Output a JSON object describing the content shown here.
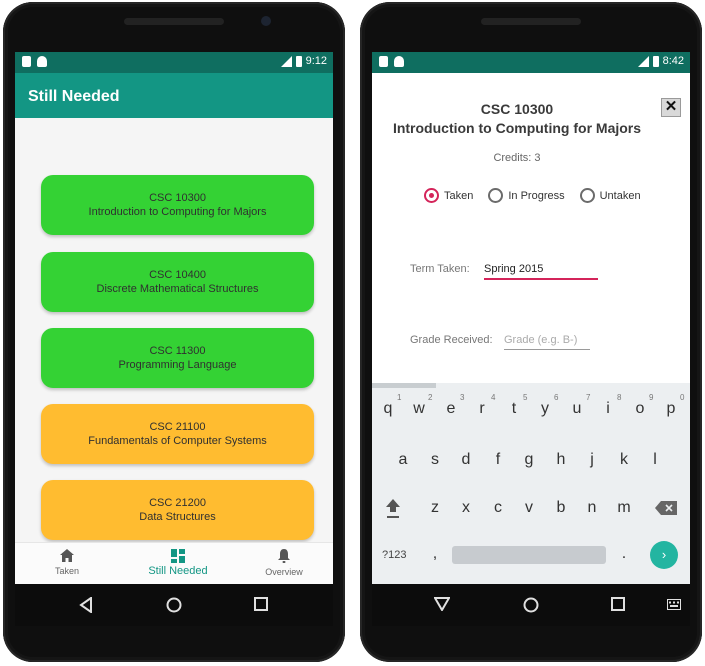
{
  "left_phone": {
    "statusbar": {
      "time": "9:12",
      "network": "LTE"
    },
    "app_bar": {
      "title": "Still Needed"
    },
    "courses": [
      {
        "code": "CSC 10300",
        "name": "Introduction to Computing for Majors",
        "status": "taken",
        "color": "#34d234"
      },
      {
        "code": "CSC 10400",
        "name": "Discrete Mathematical Structures",
        "status": "taken",
        "color": "#34d234"
      },
      {
        "code": "CSC 11300",
        "name": "Programming Language",
        "status": "taken",
        "color": "#34d234"
      },
      {
        "code": "CSC 21100",
        "name": "Fundamentals of Computer Systems",
        "status": "needed",
        "color": "#ffbc30"
      },
      {
        "code": "CSC 21200",
        "name": "Data Structures",
        "status": "needed",
        "color": "#ffbc30"
      }
    ],
    "bottom_nav": {
      "items": [
        {
          "label": "Taken",
          "icon": "home-icon",
          "active": false
        },
        {
          "label": "Still Needed",
          "icon": "dashboard-icon",
          "active": true
        },
        {
          "label": "Overview",
          "icon": "bell-icon",
          "active": false
        }
      ]
    }
  },
  "right_phone": {
    "statusbar": {
      "time": "8:42",
      "network": "LTE"
    },
    "dialog": {
      "close_label": "✕",
      "course_code": "CSC 10300",
      "course_name": "Introduction to Computing for Majors",
      "credits": "Credits: 3",
      "status_options": [
        {
          "label": "Taken",
          "checked": true
        },
        {
          "label": "In Progress",
          "checked": false
        },
        {
          "label": "Untaken",
          "checked": false
        }
      ],
      "term_label": "Term Taken:",
      "term_value": "Spring 2015",
      "grade_label": "Grade Received:",
      "grade_placeholder": "Grade (e.g. B-)"
    },
    "keyboard": {
      "row1": [
        "q",
        "w",
        "e",
        "r",
        "t",
        "y",
        "u",
        "i",
        "o",
        "p"
      ],
      "row1_hints": [
        "1",
        "2",
        "3",
        "4",
        "5",
        "6",
        "7",
        "8",
        "9",
        "0"
      ],
      "row2": [
        "a",
        "s",
        "d",
        "f",
        "g",
        "h",
        "j",
        "k",
        "l"
      ],
      "row3": [
        "z",
        "x",
        "c",
        "v",
        "b",
        "n",
        "m"
      ],
      "symbols_label": "?123",
      "comma": ",",
      "period": ".",
      "enter_label": "›"
    }
  },
  "colors": {
    "primary": "#139684",
    "primary_dark": "#0f6e60",
    "accent": "#d4245a",
    "taken_course": "#34d234",
    "needed_course": "#ffbc30"
  }
}
